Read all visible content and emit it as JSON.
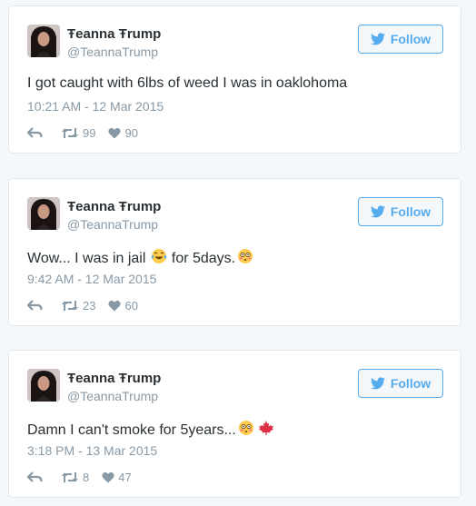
{
  "tweets": [
    {
      "name": "Ŧeanna Ŧrump",
      "handle": "@TeannaTrump",
      "follow_label": "Follow",
      "text": "I got caught with 6lbs of weed I was in oaklohoma",
      "time": "10:21 AM - 12 Mar 2015",
      "retweets": "99",
      "likes": "90"
    },
    {
      "name": "Ŧeanna Ŧrump",
      "handle": "@TeannaTrump",
      "follow_label": "Follow",
      "text_before_emoji": "Wow... I was in jail",
      "text_after_emoji": " for 5days.",
      "time": "9:42 AM - 12 Mar 2015",
      "retweets": "23",
      "likes": "60"
    },
    {
      "name": "Ŧeanna Ŧrump",
      "handle": "@TeannaTrump",
      "follow_label": "Follow",
      "text": "Damn I can't smoke for 5years...",
      "time": "3:18 PM - 13 Mar 2015",
      "retweets": "8",
      "likes": "47"
    }
  ],
  "icons": {
    "follow": "twitter-bird-icon",
    "reply": "reply-icon",
    "retweet": "retweet-icon",
    "like": "heart-icon"
  },
  "colors": {
    "accent": "#55acee",
    "text": "#292f33",
    "muted": "#8899a6",
    "background": "#f5f8fa",
    "border": "#e1e8ed"
  }
}
